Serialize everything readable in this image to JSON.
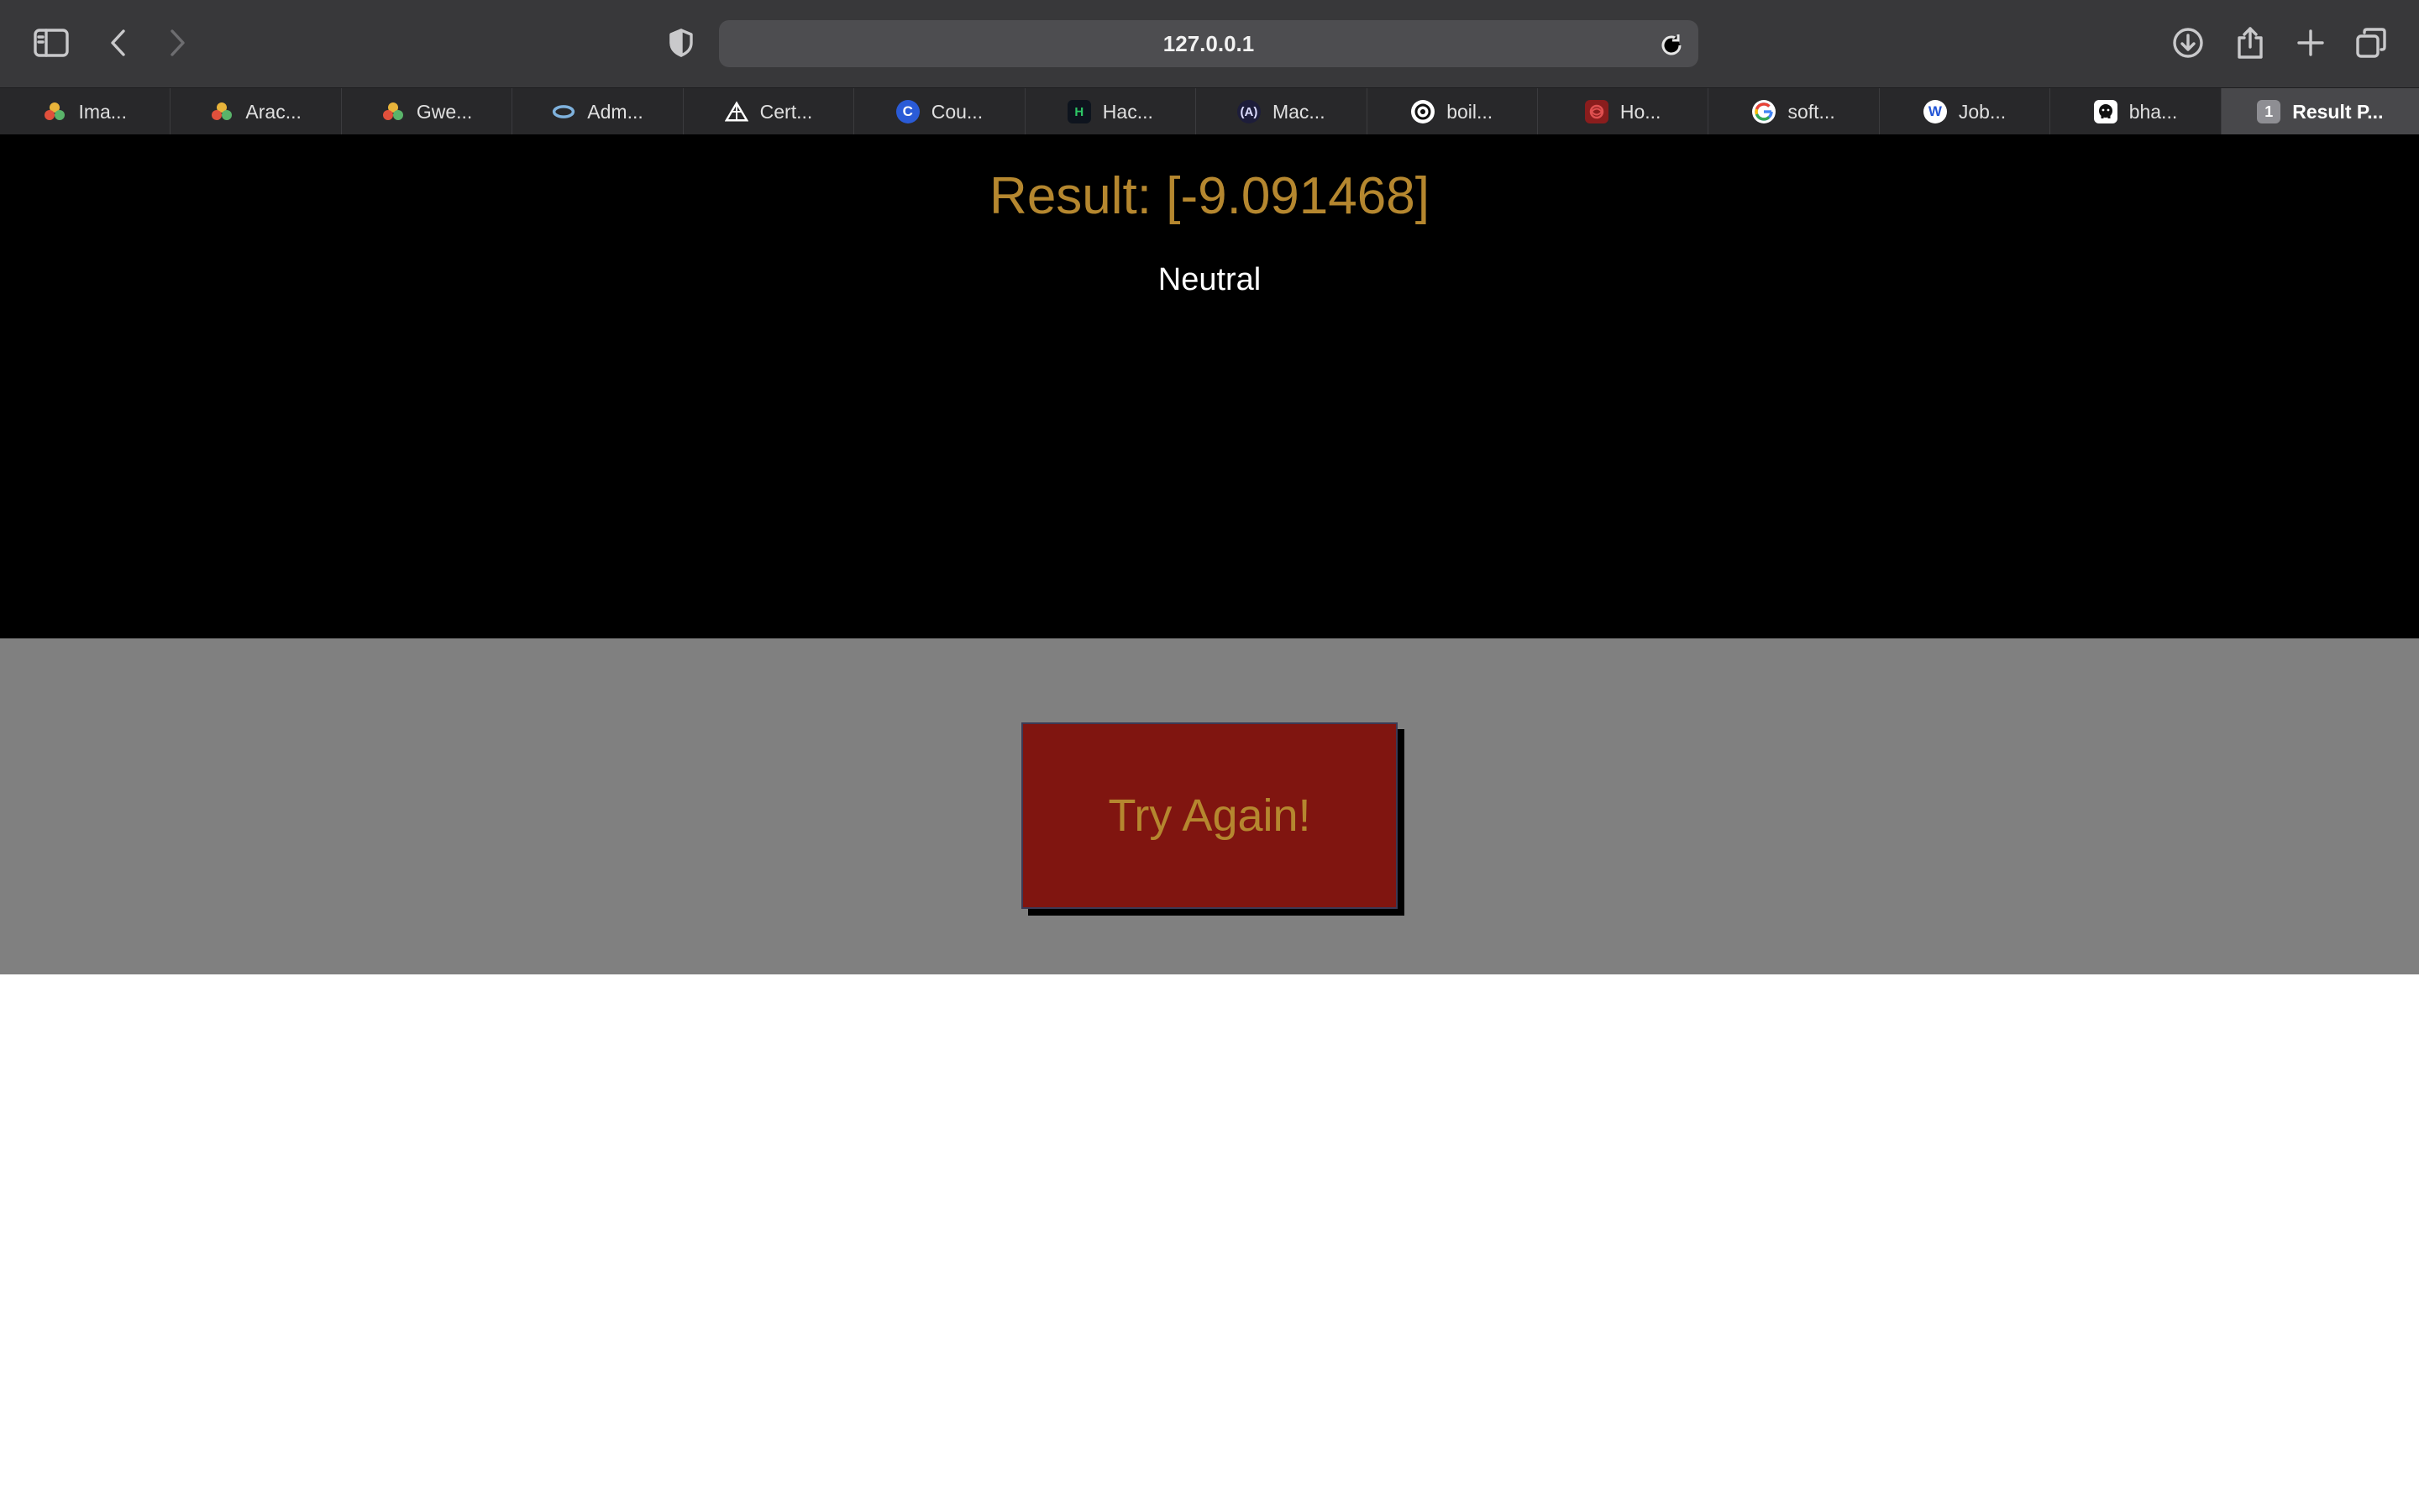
{
  "browser": {
    "url": "127.0.0.1",
    "tabs": [
      {
        "label": "Ima...",
        "favicon": "colorful-dots-icon"
      },
      {
        "label": "Arac...",
        "favicon": "colorful-dots-icon"
      },
      {
        "label": "Gwe...",
        "favicon": "colorful-dots-icon"
      },
      {
        "label": "Adm...",
        "favicon": "blue-ring-icon"
      },
      {
        "label": "Cert...",
        "favicon": "triangle-logo-icon"
      },
      {
        "label": "Cou...",
        "favicon": "coursera-c-icon"
      },
      {
        "label": "Hac...",
        "favicon": "hackerrank-h-icon"
      },
      {
        "label": "Mac...",
        "favicon": "a-bracket-icon"
      },
      {
        "label": "boil...",
        "favicon": "swirl-icon"
      },
      {
        "label": "Ho...",
        "favicon": "red-knot-icon"
      },
      {
        "label": "soft...",
        "favicon": "google-g-icon"
      },
      {
        "label": "Job...",
        "favicon": "w-badge-icon"
      },
      {
        "label": "bha...",
        "favicon": "github-icon"
      },
      {
        "label": "Result P...",
        "badge": "1",
        "active": true
      }
    ]
  },
  "page": {
    "result_title": "Result: [-9.091468]",
    "sentiment": "Neutral",
    "try_again_label": "Try Again!"
  },
  "colors": {
    "accent_gold": "#b5872f",
    "button_red": "#801510",
    "hero_bg": "#000000",
    "action_bg": "#808080"
  }
}
